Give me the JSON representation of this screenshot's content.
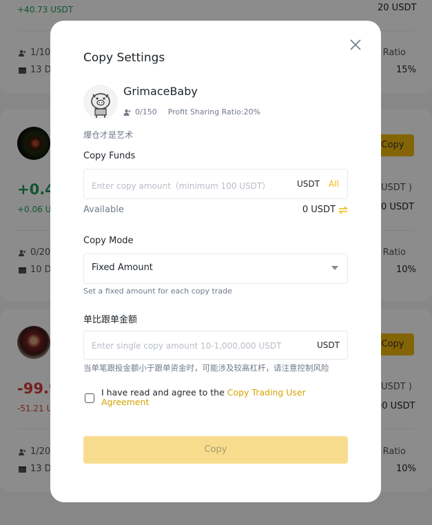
{
  "background": {
    "card1": {
      "profit_small": "+40.73 USDT",
      "right_value": "20 USDT",
      "followers": "1/10",
      "days": "13 Da",
      "ratio_label": "ng Ratio",
      "ratio_value": "15%"
    },
    "card2": {
      "copy_label": "Copy",
      "pnl_big": "+0.45",
      "pnl_small": "+0.06 US",
      "unit_label": "USDT )",
      "unit_value": "0 USDT",
      "followers": "0/200",
      "days": "10 Da",
      "ratio_label": "ng Ratio",
      "ratio_value": "10%"
    },
    "card3": {
      "copy_label": "Copy",
      "pnl_big": "-99.9",
      "pnl_small": "-51.21 U",
      "unit_label": "USDT )",
      "unit_value": "00 USDT",
      "followers": "1/200",
      "days": "13 Da",
      "ratio_label": "ng Ratio",
      "ratio_value": "10%"
    }
  },
  "modal": {
    "title": "Copy Settings",
    "trader": {
      "name": "GrimaceBaby",
      "followers": "0/150",
      "profit_sharing": "Profit Sharing Ratio:20%",
      "bio": "爆仓才是艺术"
    },
    "copy_funds": {
      "label": "Copy Funds",
      "placeholder": "Enter copy amount（minimum 100 USDT）",
      "unit": "USDT",
      "all_label": "All",
      "available_label": "Available",
      "available_value": "0 USDT"
    },
    "copy_mode": {
      "label": "Copy Mode",
      "selected": "Fixed Amount",
      "hint": "Set a fixed amount for each copy trade"
    },
    "single_amount": {
      "label": "单比跟单金额",
      "placeholder": "Enter single copy amount 10-1,000,000 USDT",
      "unit": "USDT",
      "warning": "当单笔跟投金额小于跟单资金时，可能涉及较高杠杆，请注意控制风险"
    },
    "agreement": {
      "text": "I have read and agree to the ",
      "link": "Copy Trading User Agreement"
    },
    "submit_label": "Copy"
  },
  "colors": {
    "accent": "#f0b90b",
    "profit_green": "#1f9b5a",
    "loss_red": "#d83b3b",
    "button_disabled": "#f8dc8e"
  }
}
